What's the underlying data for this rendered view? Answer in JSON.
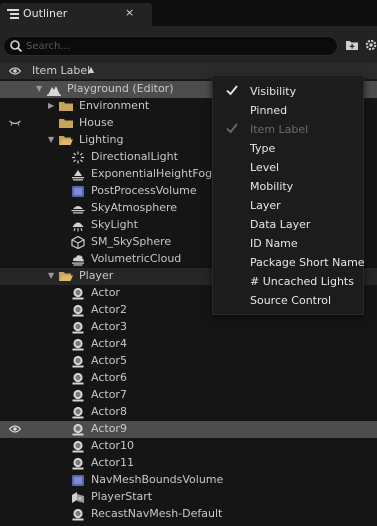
{
  "tab": {
    "title": "Outliner",
    "close": "×"
  },
  "search": {
    "placeholder": "Search..."
  },
  "header": {
    "column_label": "Item Label",
    "sort_indicator": "▲"
  },
  "tree": [
    {
      "label": "Playground (Editor)",
      "indent": 0,
      "icon": "level-icon",
      "arrow": "down",
      "selected": true
    },
    {
      "label": "Environment",
      "indent": 1,
      "icon": "folder-icon",
      "arrow": "right"
    },
    {
      "label": "House",
      "indent": 1,
      "icon": "folder-icon",
      "arrow": ""
    },
    {
      "label": "Lighting",
      "indent": 1,
      "icon": "folder-open-icon",
      "arrow": "down"
    },
    {
      "label": "DirectionalLight",
      "indent": 2,
      "icon": "directional-light-icon"
    },
    {
      "label": "ExponentialHeightFog",
      "indent": 2,
      "icon": "fog-icon"
    },
    {
      "label": "PostProcessVolume",
      "indent": 2,
      "icon": "volume-icon"
    },
    {
      "label": "SkyAtmosphere",
      "indent": 2,
      "icon": "sky-atmosphere-icon"
    },
    {
      "label": "SkyLight",
      "indent": 2,
      "icon": "skylight-icon"
    },
    {
      "label": "SM_SkySphere",
      "indent": 2,
      "icon": "static-mesh-icon"
    },
    {
      "label": "VolumetricCloud",
      "indent": 2,
      "icon": "cloud-icon"
    },
    {
      "label": "Player",
      "indent": 1,
      "icon": "folder-open-icon",
      "arrow": "down",
      "highlight": true
    },
    {
      "label": "Actor",
      "indent": 2,
      "icon": "actor-icon"
    },
    {
      "label": "Actor2",
      "indent": 2,
      "icon": "actor-icon"
    },
    {
      "label": "Actor3",
      "indent": 2,
      "icon": "actor-icon"
    },
    {
      "label": "Actor4",
      "indent": 2,
      "icon": "actor-icon"
    },
    {
      "label": "Actor5",
      "indent": 2,
      "icon": "actor-icon"
    },
    {
      "label": "Actor6",
      "indent": 2,
      "icon": "actor-icon"
    },
    {
      "label": "Actor7",
      "indent": 2,
      "icon": "actor-icon"
    },
    {
      "label": "Actor8",
      "indent": 2,
      "icon": "actor-icon"
    },
    {
      "label": "Actor9",
      "indent": 2,
      "icon": "actor-icon",
      "selected": true,
      "visible_eye": true
    },
    {
      "label": "Actor10",
      "indent": 2,
      "icon": "actor-icon"
    },
    {
      "label": "Actor11",
      "indent": 2,
      "icon": "actor-icon"
    },
    {
      "label": "NavMeshBoundsVolume",
      "indent": 2,
      "icon": "volume-icon"
    },
    {
      "label": "PlayerStart",
      "indent": 2,
      "icon": "player-start-icon"
    },
    {
      "label": "RecastNavMesh-Default",
      "indent": 2,
      "icon": "actor-icon"
    }
  ],
  "menu": [
    {
      "label": "Visibility",
      "checked": true,
      "disabled": false
    },
    {
      "label": "Pinned",
      "checked": false,
      "disabled": false
    },
    {
      "label": "Item Label",
      "checked": true,
      "disabled": true
    },
    {
      "label": "Type",
      "checked": false,
      "disabled": false
    },
    {
      "label": "Level",
      "checked": false,
      "disabled": false
    },
    {
      "label": "Mobility",
      "checked": false,
      "disabled": false
    },
    {
      "label": "Layer",
      "checked": false,
      "disabled": false
    },
    {
      "label": "Data Layer",
      "checked": false,
      "disabled": false
    },
    {
      "label": "ID Name",
      "checked": false,
      "disabled": false
    },
    {
      "label": "Package Short Name",
      "checked": false,
      "disabled": false
    },
    {
      "label": "# Uncached Lights",
      "checked": false,
      "disabled": false
    },
    {
      "label": "Source Control",
      "checked": false,
      "disabled": false
    }
  ],
  "colors": {
    "folder": "#c8a45a",
    "selected_row": "#4d4d4d",
    "menu_bg": "#1c1c1c"
  }
}
